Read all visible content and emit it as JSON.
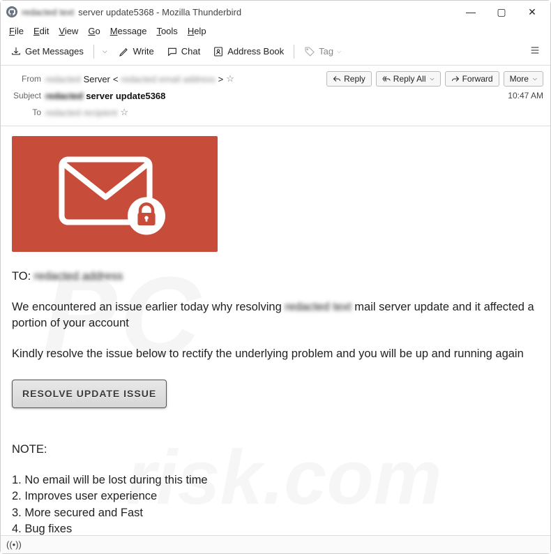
{
  "window": {
    "title_redacted": "redacted text",
    "title_suffix": "server update5368 - Mozilla Thunderbird"
  },
  "menu": {
    "file": "File",
    "edit": "Edit",
    "view": "View",
    "go": "Go",
    "message": "Message",
    "tools": "Tools",
    "help": "Help"
  },
  "toolbar": {
    "get_messages": "Get Messages",
    "write": "Write",
    "chat": "Chat",
    "address_book": "Address Book",
    "tag": "Tag"
  },
  "header": {
    "from_label": "From",
    "from_name": "Server",
    "from_redacted_prefix": "redacted",
    "from_redacted_email": "redacted email address",
    "subject_label": "Subject",
    "subject_redacted": "redacted",
    "subject_clear": "server update5368",
    "to_label": "To",
    "to_redacted": "redacted recipient",
    "time": "10:47 AM"
  },
  "actions": {
    "reply": "Reply",
    "reply_all": "Reply All",
    "forward": "Forward",
    "more": "More"
  },
  "body": {
    "to_label": "TO:",
    "to_redacted": "redacted address",
    "para1_a": "We encountered an issue earlier today why resolving ",
    "para1_blur": "redacted text",
    "para1_b": " mail server update and it affected a portion of your account",
    "para2": "Kindly resolve the issue below to rectify the underlying problem and you will be up and running again",
    "button": "RESOLVE UPDATE ISSUE",
    "note_label": "NOTE:",
    "notes": [
      "1. No email will be lost during this time",
      "2. Improves user experience",
      "3. More secured and Fast",
      "4. Bug fixes"
    ]
  },
  "status": {
    "connection": "((•))"
  },
  "watermark": {
    "line1": "PC",
    "line2": "risk.com"
  }
}
